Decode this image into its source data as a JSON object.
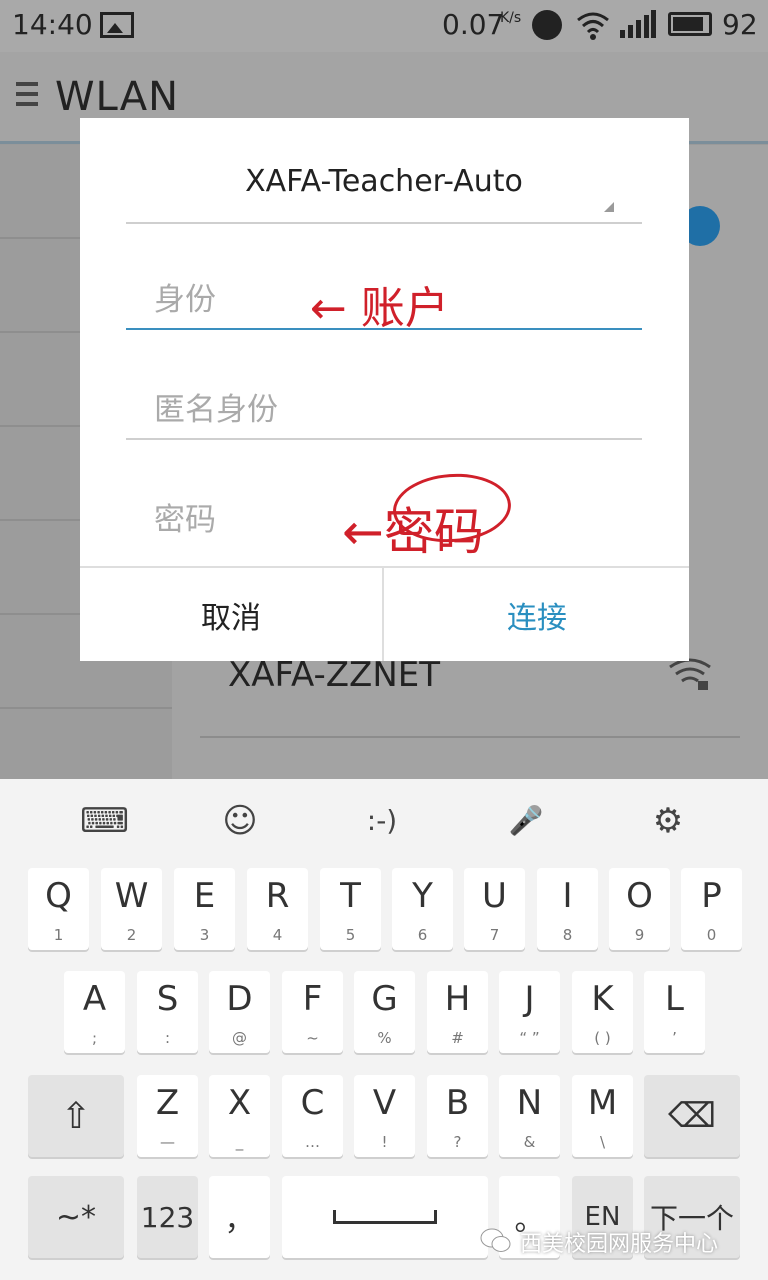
{
  "status_bar": {
    "time": "14:40",
    "speed": "0.07",
    "speed_unit": "K/s",
    "battery": "92"
  },
  "app_bar": {
    "title": "WLAN"
  },
  "background": {
    "network_name": "XAFA-ZZNET"
  },
  "dialog": {
    "network": "XAFA-Teacher-Auto",
    "identity_placeholder": "身份",
    "anonymous_identity_placeholder": "匿名身份",
    "password_placeholder": "密码",
    "cancel_label": "取消",
    "connect_label": "连接",
    "annotation_account": "← 账户",
    "annotation_password": "←密码"
  },
  "keyboard": {
    "toolbar": [
      {
        "name": "keyboard-switch-icon",
        "glyph": "⌨"
      },
      {
        "name": "emoji-icon",
        "glyph": "☺"
      },
      {
        "name": "emoticon-icon",
        "glyph": ":-)"
      },
      {
        "name": "microphone-icon",
        "glyph": "🎤"
      },
      {
        "name": "settings-gear-icon",
        "glyph": "⚙"
      }
    ],
    "row1": [
      {
        "main": "Q",
        "sub": "1"
      },
      {
        "main": "W",
        "sub": "2"
      },
      {
        "main": "E",
        "sub": "3"
      },
      {
        "main": "R",
        "sub": "4"
      },
      {
        "main": "T",
        "sub": "5"
      },
      {
        "main": "Y",
        "sub": "6"
      },
      {
        "main": "U",
        "sub": "7"
      },
      {
        "main": "I",
        "sub": "8"
      },
      {
        "main": "O",
        "sub": "9"
      },
      {
        "main": "P",
        "sub": "0"
      }
    ],
    "row2": [
      {
        "main": "A",
        "sub": ";"
      },
      {
        "main": "S",
        "sub": ":"
      },
      {
        "main": "D",
        "sub": "@"
      },
      {
        "main": "F",
        "sub": "~"
      },
      {
        "main": "G",
        "sub": "%"
      },
      {
        "main": "H",
        "sub": "#"
      },
      {
        "main": "J",
        "sub": "“ ”"
      },
      {
        "main": "K",
        "sub": "( )"
      },
      {
        "main": "L",
        "sub": "’"
      }
    ],
    "row3": [
      {
        "main": "Z",
        "sub": "—"
      },
      {
        "main": "X",
        "sub": "_"
      },
      {
        "main": "C",
        "sub": "…"
      },
      {
        "main": "V",
        "sub": "!"
      },
      {
        "main": "B",
        "sub": "?"
      },
      {
        "main": "N",
        "sub": "&"
      },
      {
        "main": "M",
        "sub": "\\"
      }
    ],
    "shift_glyph": "⇧",
    "backspace_glyph": "⌫",
    "symbols_label": "~*",
    "numbers_label": "123",
    "comma_label": "，",
    "period_label": "。",
    "lang_label": "EN",
    "next_label": "下一个"
  },
  "watermark": "西美校园网服务中心"
}
